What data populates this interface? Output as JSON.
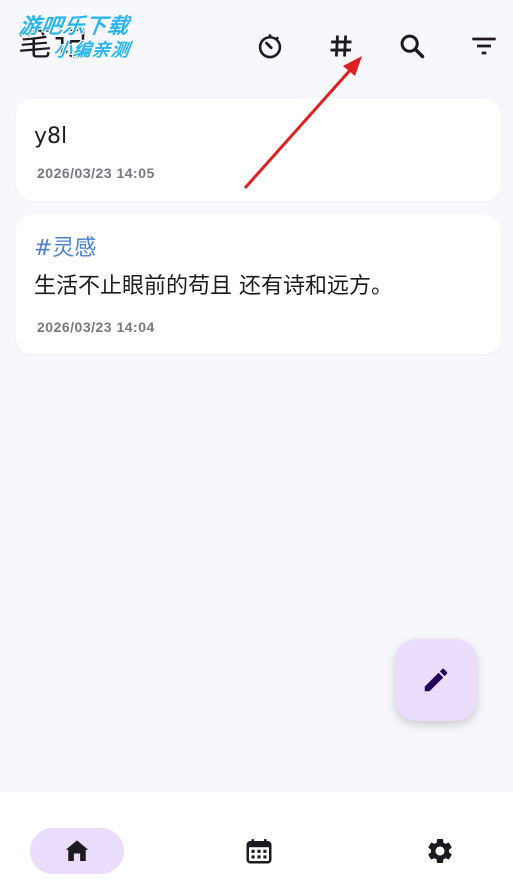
{
  "header": {
    "title": "笔记",
    "watermark_line1": "游吧乐下载",
    "watermark_line2": "小编亲测",
    "actions": [
      {
        "name": "timer-icon"
      },
      {
        "name": "hashtag-icon"
      },
      {
        "name": "search-icon"
      },
      {
        "name": "filter-icon"
      }
    ]
  },
  "notes": [
    {
      "title": "y8l",
      "date": "2026/03/23 14:05"
    },
    {
      "tag": "#灵感",
      "body": "生活不止眼前的苟且 还有诗和远方。",
      "date": "2026/03/23 14:04"
    }
  ],
  "fab": {
    "icon": "pencil-icon"
  },
  "nav": {
    "items": [
      {
        "icon": "home-icon",
        "active": true
      },
      {
        "icon": "calendar-icon",
        "active": false
      },
      {
        "icon": "settings-icon",
        "active": false
      }
    ]
  },
  "colors": {
    "background": "#f7f8fb",
    "card": "#ffffff",
    "accent_container": "#eadcfb",
    "tag": "#4a7fd0",
    "annotation_arrow": "#e02020"
  }
}
